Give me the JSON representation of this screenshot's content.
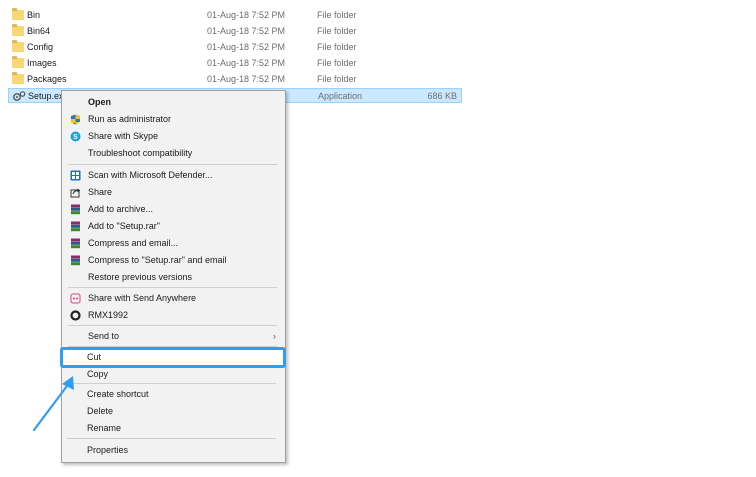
{
  "files": [
    {
      "name": "Bin",
      "date": "01-Aug-18 7:52 PM",
      "type": "File folder",
      "size": "",
      "icon": "folder-icon",
      "selected": false
    },
    {
      "name": "Bin64",
      "date": "01-Aug-18 7:52 PM",
      "type": "File folder",
      "size": "",
      "icon": "folder-icon",
      "selected": false
    },
    {
      "name": "Config",
      "date": "01-Aug-18 7:52 PM",
      "type": "File folder",
      "size": "",
      "icon": "folder-icon",
      "selected": false
    },
    {
      "name": "Images",
      "date": "01-Aug-18 7:52 PM",
      "type": "File folder",
      "size": "",
      "icon": "folder-icon",
      "selected": false
    },
    {
      "name": "Packages",
      "date": "01-Aug-18 7:52 PM",
      "type": "File folder",
      "size": "",
      "icon": "folder-icon",
      "selected": false
    },
    {
      "name": "Setup.ex",
      "date": "",
      "type": "Application",
      "size": "686 KB",
      "icon": "setup-app-icon",
      "selected": true
    }
  ],
  "menu": {
    "open": "Open",
    "run_as_admin": "Run as administrator",
    "share_skype": "Share with Skype",
    "troubleshoot": "Troubleshoot compatibility",
    "scan_defender": "Scan with Microsoft Defender...",
    "share": "Share",
    "add_archive": "Add to archive...",
    "add_setup_rar": "Add to \"Setup.rar\"",
    "compress_email": "Compress and email...",
    "compress_rar_email": "Compress to \"Setup.rar\" and email",
    "restore_versions": "Restore previous versions",
    "share_send_anywhere": "Share with Send Anywhere",
    "rmx": "RMX1992",
    "send_to": "Send to",
    "cut": "Cut",
    "copy": "Copy",
    "create_shortcut": "Create shortcut",
    "delete": "Delete",
    "rename": "Rename",
    "properties": "Properties",
    "submenu_arrow": "›"
  },
  "colors": {
    "highlight": "#2e9df4",
    "selection": "#cce8ff"
  }
}
